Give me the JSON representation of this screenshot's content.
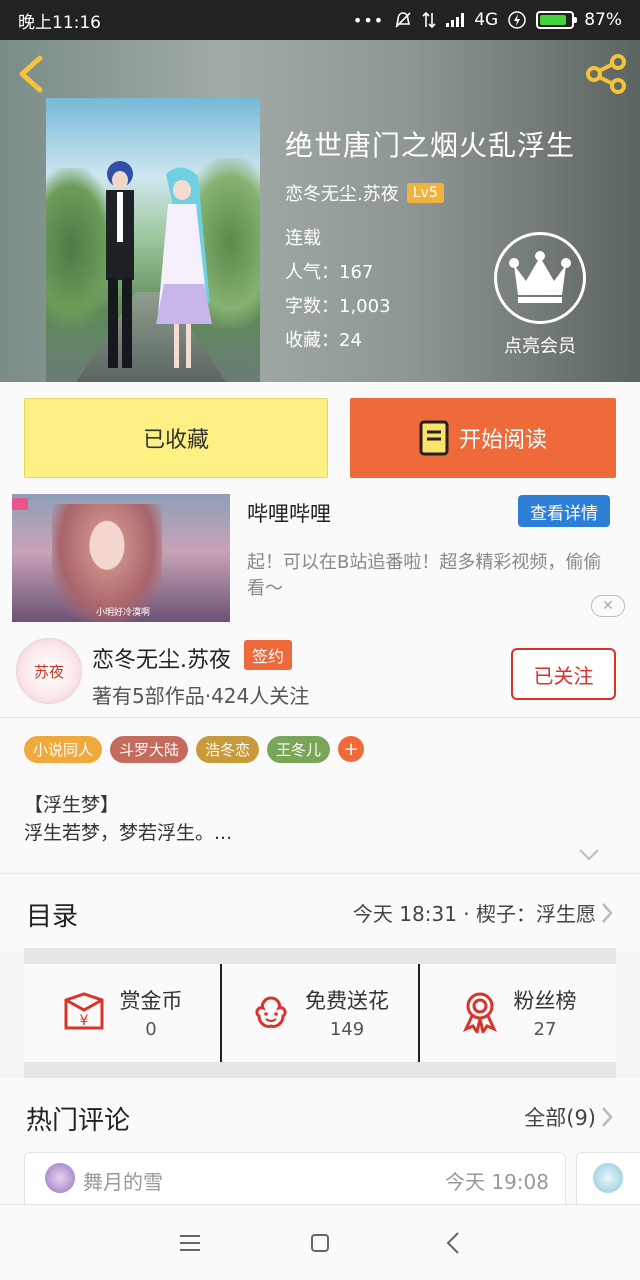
{
  "status_bar": {
    "time": "晚上11:16",
    "icons": [
      "dots-icon",
      "mute-icon",
      "data-transfer-icon",
      "signal-icon",
      "bolt-icon"
    ],
    "network": "4G",
    "battery": "87%",
    "battery_level": 0.87
  },
  "header": {
    "back_icon": "chevron-left-icon",
    "share_icon": "share-icon",
    "title": "绝世唐门之烟火乱浮生",
    "author": "恋冬无尘.苏夜",
    "level": "Lv5",
    "status": "连载",
    "popularity": "人气：167",
    "word_count": "字数：1,003",
    "favorites": "收藏：24",
    "vip_label": "点亮会员",
    "accent": "#f2b33d"
  },
  "actions": {
    "favorite_label": "已收藏",
    "read_label": "开始阅读",
    "favorite_color": "#fcf182",
    "read_color": "#ee6a3a"
  },
  "ad": {
    "title": "哔哩哔哩",
    "detail_button": "查看详情",
    "description": "起！可以在B站追番啦！超多精彩视频，偷偷看～",
    "image_caption": "小明好冷漠啊",
    "close_icon": "close-icon"
  },
  "author_card": {
    "avatar_text": "苏夜",
    "name": "恋冬无尘.苏夜",
    "badge": "签约",
    "meta": "著有5部作品·424人关注",
    "follow_label": "已关注"
  },
  "tags": [
    {
      "label": "小说同人",
      "color": "#f0a93c"
    },
    {
      "label": "斗罗大陆",
      "color": "#c56b5e"
    },
    {
      "label": "浩冬恋",
      "color": "#c79a3a"
    },
    {
      "label": "王冬儿",
      "color": "#7aa65a"
    }
  ],
  "intro": {
    "line1": "【浮生梦】",
    "line2": "浮生若梦，梦若浮生。..."
  },
  "catalog": {
    "title": "目录",
    "latest": "今天 18:31 · 楔子：浮生愿"
  },
  "stats": [
    {
      "label": "赏金币",
      "value": "0",
      "icon": "coin-envelope-icon"
    },
    {
      "label": "免费送花",
      "value": "149",
      "icon": "flower-icon"
    },
    {
      "label": "粉丝榜",
      "value": "27",
      "icon": "ribbon-icon"
    }
  ],
  "comments": {
    "title": "热门评论",
    "all_label": "全部(9)",
    "first": {
      "user": "舞月的雪",
      "time": "今天 19:08"
    }
  },
  "nav": [
    "menu-icon",
    "home-icon",
    "back-icon"
  ]
}
